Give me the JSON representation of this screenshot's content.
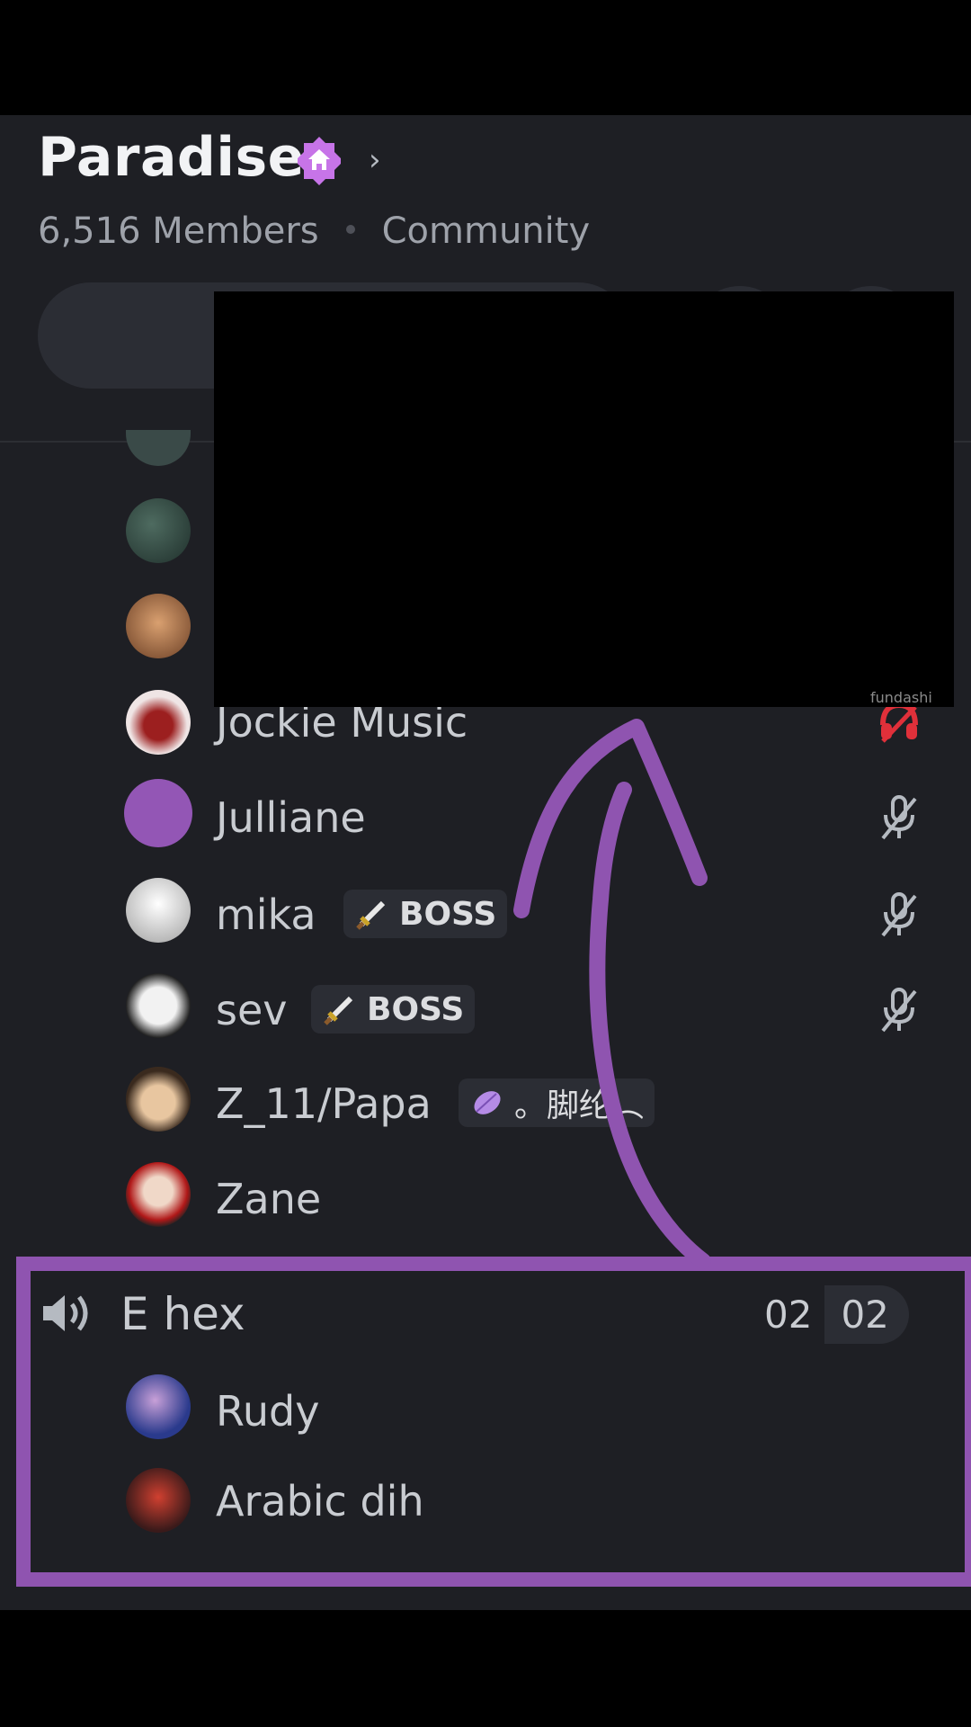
{
  "server": {
    "name": "Paradise",
    "members": "6,516 Members",
    "type": "Community"
  },
  "members": [
    {
      "name": "Jockie Music",
      "status": "deafened"
    },
    {
      "name": "Julliane",
      "status": "muted"
    },
    {
      "name": "mika",
      "tag": "BOSS",
      "tag_icon": "sword-icon",
      "status": "muted"
    },
    {
      "name": "sev",
      "tag": "BOSS",
      "tag_icon": "sword-icon",
      "status": "muted"
    },
    {
      "name": "Z_11/Papa",
      "tag": "。脚纶︵",
      "tag_icon": "leaf-icon"
    },
    {
      "name": "Zane"
    }
  ],
  "voice_channel": {
    "name": "E hex",
    "current": "02",
    "max": "02",
    "members": [
      "Rudy",
      "Arabic dih"
    ]
  },
  "watermark": "fundashi",
  "colors": {
    "background": "#1e1f24",
    "highlight_border": "#8f54b0",
    "deafen_red": "#e0303a",
    "nitro_badge": "#c774e8"
  }
}
